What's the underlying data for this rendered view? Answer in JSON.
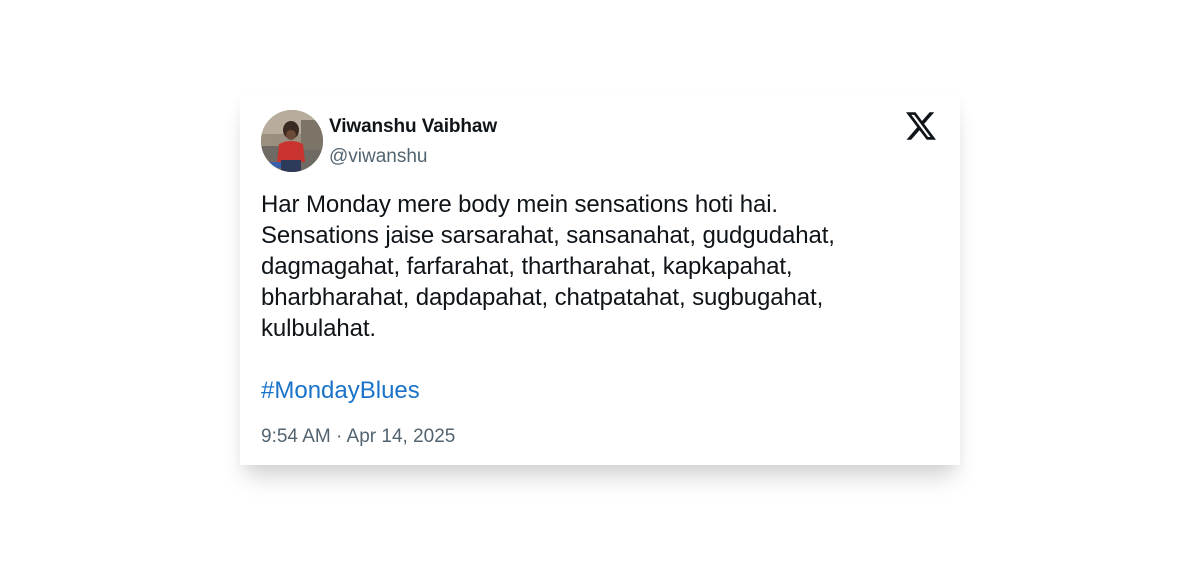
{
  "tweet": {
    "author": {
      "name": "Viwanshu Vaibhaw",
      "handle": "@viwanshu",
      "avatar_icon": "user-avatar-photo"
    },
    "platform_icon": "x-logo-icon",
    "text": "Har Monday mere body mein sensations hoti hai.\nSensations jaise sarsarahat, sansanahat, gudgudahat,\ndagmagahat, farfarahat, thartharahat, kapkapahat,\nbharbharahat, dapdapahat, chatpatahat, sugbugahat,\nkulbulahat.",
    "hashtag": "#MondayBlues",
    "timestamp": "9:54 AM · Apr 14, 2025"
  },
  "colors": {
    "text_primary": "#0f1419",
    "text_secondary": "#536471",
    "hashtag": "#1a73c9",
    "background": "#ffffff"
  }
}
